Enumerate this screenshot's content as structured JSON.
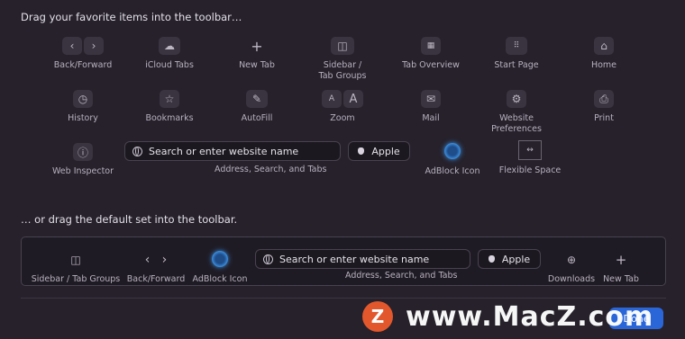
{
  "headings": {
    "drag": "Drag your favorite items into the toolbar…",
    "default_set": "… or drag the default set into the toolbar."
  },
  "palette": {
    "back_forward": "Back/Forward",
    "icloud_tabs": "iCloud Tabs",
    "new_tab": "New Tab",
    "sidebar_line1": "Sidebar /",
    "sidebar_line2": "Tab Groups",
    "tab_overview": "Tab Overview",
    "start_page": "Start Page",
    "home": "Home",
    "history": "History",
    "bookmarks": "Bookmarks",
    "autofill": "AutoFill",
    "zoom": "Zoom",
    "zoom_small": "A",
    "zoom_large": "A",
    "mail": "Mail",
    "website_prefs_line1": "Website",
    "website_prefs_line2": "Preferences",
    "print": "Print",
    "web_inspector": "Web Inspector",
    "address_placeholder": "Search or enter website name",
    "address_label": "Address, Search, and Tabs",
    "apple_bookmark": "Apple",
    "adblock": "AdBlock Icon",
    "flexible_space": "Flexible Space"
  },
  "default_set": {
    "sidebar": "Sidebar / Tab Groups",
    "back_forward": "Back/Forward",
    "adblock": "AdBlock Icon",
    "address_placeholder": "Search or enter website name",
    "address_label": "Address, Search, and Tabs",
    "apple_bookmark": "Apple",
    "downloads": "Downloads",
    "new_tab": "New Tab"
  },
  "done_button": "Done",
  "watermark": "www.MacZ.com",
  "watermark_badge": "Z",
  "colors": {
    "background": "#26212b",
    "accent": "#2a66d8",
    "watermark_badge": "#e2582c"
  }
}
